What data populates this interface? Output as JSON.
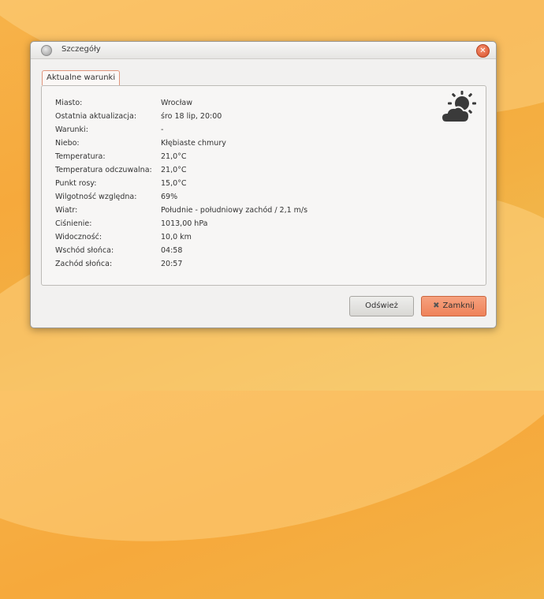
{
  "window": {
    "title": "Szczegóły"
  },
  "tabs": [
    {
      "label": "Aktualne warunki"
    }
  ],
  "icon": {
    "weather": "partly-cloudy-icon",
    "close": "close-icon"
  },
  "details": [
    {
      "label": "Miasto:",
      "value": "Wrocław"
    },
    {
      "label": "Ostatnia aktualizacja:",
      "value": "śro 18 lip, 20:00"
    },
    {
      "label": "Warunki:",
      "value": "-"
    },
    {
      "label": "Niebo:",
      "value": "Kłębiaste chmury"
    },
    {
      "label": "Temperatura:",
      "value": "21,0°C"
    },
    {
      "label": "Temperatura odczuwalna:",
      "value": "21,0°C"
    },
    {
      "label": "Punkt rosy:",
      "value": "15,0°C"
    },
    {
      "label": "Wilgotność względna:",
      "value": "69%"
    },
    {
      "label": "Wiatr:",
      "value": "Południe - południowy zachód / 2,1 m/s"
    },
    {
      "label": "Ciśnienie:",
      "value": "1013,00 hPa"
    },
    {
      "label": "Widoczność:",
      "value": "10,0 km"
    },
    {
      "label": "Wschód słońca:",
      "value": "04:58"
    },
    {
      "label": "Zachód słońca:",
      "value": "20:57"
    }
  ],
  "buttons": {
    "refresh": "Odśwież",
    "close": "Zamknij"
  },
  "colors": {
    "accent": "#ef8259",
    "close_button": "#d8502a"
  }
}
